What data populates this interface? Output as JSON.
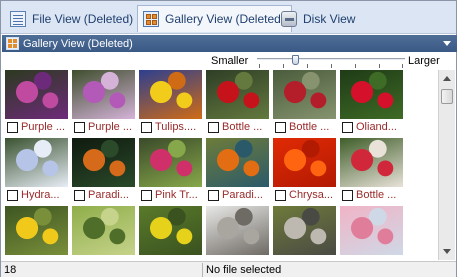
{
  "tabs": [
    {
      "label": "File View (Deleted)",
      "icon": "file-list-icon"
    },
    {
      "label": "Gallery View (Deleted)",
      "icon": "gallery-grid-icon"
    },
    {
      "label": "Disk View",
      "icon": "disk-icon"
    }
  ],
  "panel": {
    "title": "Gallery View (Deleted)"
  },
  "zoom": {
    "smaller_label": "Smaller",
    "larger_label": "Larger",
    "level": 0.25
  },
  "gallery": {
    "items": [
      {
        "caption": "Purple ...",
        "palette": [
          "#2b3a1f",
          "#c04aa0",
          "#6e2a7a"
        ]
      },
      {
        "caption": "Purple ...",
        "palette": [
          "#3e4e2d",
          "#b35ab9",
          "#d5b3d9"
        ]
      },
      {
        "caption": "Tulips....",
        "palette": [
          "#2d3f8f",
          "#f2cc1a",
          "#d06b15"
        ]
      },
      {
        "caption": "Bottle ...",
        "palette": [
          "#2e3e26",
          "#c6121a",
          "#63793e"
        ]
      },
      {
        "caption": "Bottle ...",
        "palette": [
          "#4a5c3c",
          "#b41d2a",
          "#86936e"
        ]
      },
      {
        "caption": "Oliand...",
        "palette": [
          "#1f3b17",
          "#d4102a",
          "#3e6b25"
        ]
      },
      {
        "caption": "Hydra...",
        "palette": [
          "#3a5230",
          "#b6c4e8",
          "#e7edf6"
        ]
      },
      {
        "caption": "Paradi...",
        "palette": [
          "#0f1a0f",
          "#d46a1a",
          "#2a4a2a"
        ]
      },
      {
        "caption": "Pink Tr...",
        "palette": [
          "#3a4a2a",
          "#d0306a",
          "#87a84a"
        ]
      },
      {
        "caption": "Paradi...",
        "palette": [
          "#6e7c3a",
          "#e26d13",
          "#2a5a6a"
        ]
      },
      {
        "caption": "Chrysa...",
        "palette": [
          "#e02a05",
          "#ff6410",
          "#b31a02"
        ]
      },
      {
        "caption": "Bottle ...",
        "palette": [
          "#3f5e2a",
          "#d0283a",
          "#e8e2d8"
        ]
      },
      {
        "caption": "",
        "palette": [
          "#3d5522",
          "#f0c91a",
          "#7a8f3a"
        ]
      },
      {
        "caption": "",
        "palette": [
          "#8fae4a",
          "#4f6e2a",
          "#c6d38a"
        ]
      },
      {
        "caption": "",
        "palette": [
          "#5a7a2a",
          "#e6d21a",
          "#3a5220"
        ]
      },
      {
        "caption": "",
        "palette": [
          "#e8e8e6",
          "#a9a6a0",
          "#6e6a64"
        ]
      },
      {
        "caption": "",
        "palette": [
          "#6e7a3a",
          "#bdb8b0",
          "#4a4a44"
        ]
      },
      {
        "caption": "",
        "palette": [
          "#f0b4c6",
          "#e07d9a",
          "#cfd8e6"
        ]
      }
    ]
  },
  "status": {
    "count": "18",
    "message": "No file selected"
  }
}
